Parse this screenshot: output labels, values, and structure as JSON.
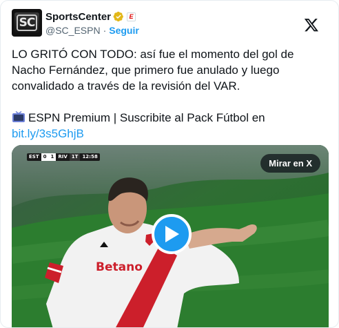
{
  "tweet": {
    "display_name": "SportsCenter",
    "handle": "@SC_ESPN",
    "separator": "·",
    "follow_label": "Seguir",
    "avatar_text": "SC",
    "badge_text": "E",
    "text_main": "LO GRITÓ CON TODO: así fue el momento del gol de Nacho Fernández, que primero fue anulado y luego convalidado a través de la revisión del VAR.",
    "promo_text": "ESPN Premium | Suscribite al Pack Fútbol en ",
    "promo_link": "bit.ly/3s5GhjB"
  },
  "media": {
    "watch_label": "Mirar en X",
    "scoreboard": {
      "home": "EST",
      "home_score": "0",
      "away_score": "1",
      "away": "RIV",
      "period": "1T",
      "clock": "12:58"
    },
    "jersey_text": "Betano"
  },
  "icons": {
    "verified": "verified-badge-icon",
    "close": "x-logo-icon",
    "tv": "tv-icon",
    "play": "play-icon"
  },
  "colors": {
    "link": "#1d9bf0",
    "verified_gold": "#e2b719",
    "text": "#0f1419",
    "muted": "#536471"
  }
}
